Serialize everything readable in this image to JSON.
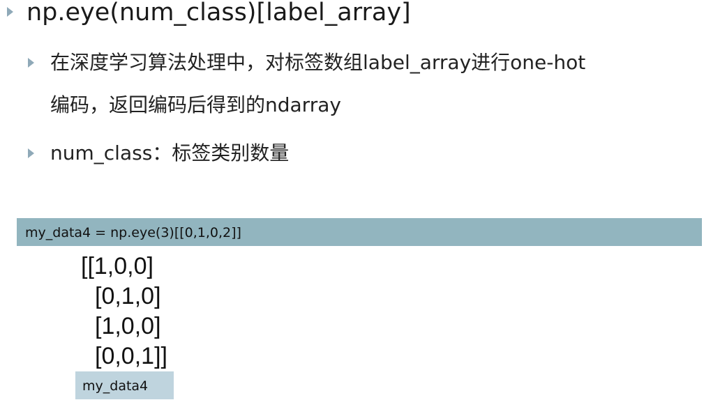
{
  "heading": {
    "text": "np.eye(num_class)[label_array]"
  },
  "bullets": [
    {
      "line1": "在深度学习算法处理中，对标签数组label_array进行one-hot",
      "line2": "编码，返回编码后得到的ndarray"
    },
    {
      "line1": "num_class：标签类别数量"
    }
  ],
  "code": {
    "statement": "my_data4 = np.eye(3)[[0,1,0,2]]",
    "result_rows": [
      "[[1,0,0]",
      "[0,1,0]",
      "[1,0,0]",
      "[0,0,1]]"
    ],
    "variable": "my_data4"
  },
  "colors": {
    "bullet_marker": "#8fa9b8",
    "code_bar": "#92b5bf",
    "variable_box": "#bfd4de"
  },
  "icons": {
    "bullet": "triangle-right-icon"
  }
}
